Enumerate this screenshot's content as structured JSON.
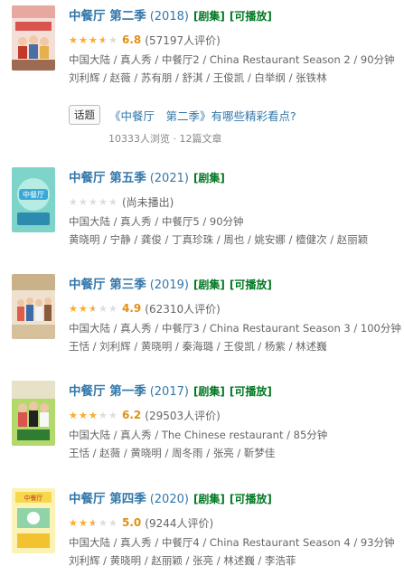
{
  "colors": {
    "link": "#3377aa",
    "tag": "#007722",
    "star": "#ffac2d",
    "score": "#e09015"
  },
  "items": [
    {
      "title": "中餐厅 第二季",
      "year": "(2018)",
      "tags": [
        "[剧集]",
        "[可播放]"
      ],
      "rating": 3.5,
      "score": "6.8",
      "votes": "(57197人评价)",
      "meta": "中国大陆 / 真人秀 / 中餐厅2 / China Restaurant Season 2 / 90分钟",
      "cast": "刘利辉 / 赵薇 / 苏有朋 / 舒淇 / 王俊凯 / 白举纲 / 张铁林"
    },
    {
      "title": "中餐厅 第五季",
      "year": "(2021)",
      "tags": [
        "[剧集]"
      ],
      "rating": 0,
      "score": "",
      "votes": "(尚未播出)",
      "meta": "中国大陆 / 真人秀 / 中餐厅5 / 90分钟",
      "cast": "黄晓明 / 宁静 / 龚俊 / 丁真珍珠 / 周也 / 姚安娜 / 檀健次 / 赵丽颖"
    },
    {
      "title": "中餐厅 第三季",
      "year": "(2019)",
      "tags": [
        "[剧集]",
        "[可播放]"
      ],
      "rating": 2.5,
      "score": "4.9",
      "votes": "(62310人评价)",
      "meta": "中国大陆 / 真人秀 / 中餐厅3 / China Restaurant Season 3 / 100分钟",
      "cast": "王恬 / 刘利辉 / 黄晓明 / 秦海璐 / 王俊凯 / 杨紫 / 林述巍"
    },
    {
      "title": "中餐厅 第一季",
      "year": "(2017)",
      "tags": [
        "[剧集]",
        "[可播放]"
      ],
      "rating": 3,
      "score": "6.2",
      "votes": "(29503人评价)",
      "meta": "中国大陆 / 真人秀 / The Chinese restaurant / 85分钟",
      "cast": "王恬 / 赵薇 / 黄晓明 / 周冬雨 / 张亮 / 靳梦佳"
    },
    {
      "title": "中餐厅 第四季",
      "year": "(2020)",
      "tags": [
        "[剧集]",
        "[可播放]"
      ],
      "rating": 2.5,
      "score": "5.0",
      "votes": "(9244人评价)",
      "meta": "中国大陆 / 真人秀 / 中餐厅4 / China Restaurant Season 4 / 93分钟",
      "cast": "刘利辉 / 黄晓明 / 赵丽颖 / 张亮 / 林述巍 / 李浩菲"
    }
  ],
  "topic": {
    "badge": "话题",
    "title": "《中餐厅　第二季》有哪些精彩看点?",
    "stats": "10333人浏览 · 12篇文章"
  },
  "posters": [
    {
      "logo": "",
      "icon": "restaurant-poster-icon"
    },
    {
      "logo": "中餐厅",
      "icon": "restaurant-poster-icon"
    },
    {
      "logo": "",
      "icon": "restaurant-poster-icon"
    },
    {
      "logo": "",
      "icon": "restaurant-poster-icon"
    },
    {
      "logo": "中餐厅",
      "icon": "restaurant-poster-icon"
    }
  ]
}
